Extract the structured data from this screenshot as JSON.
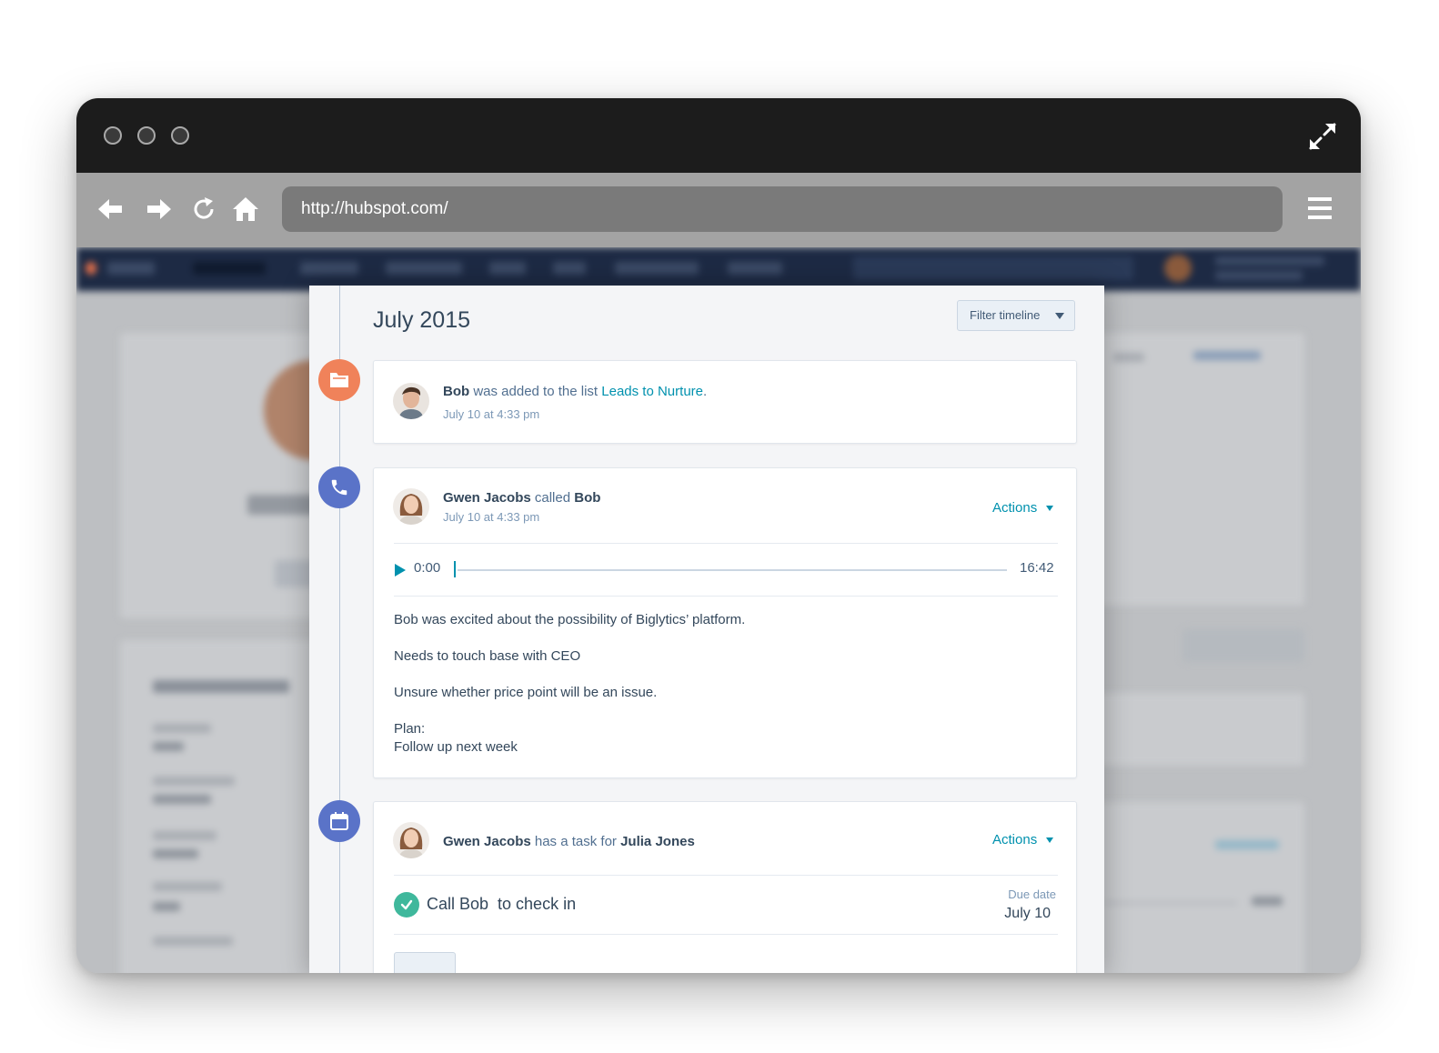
{
  "browser": {
    "url": "http://hubspot.com/"
  },
  "timeline": {
    "month": "July 2015",
    "filter_label": "Filter timeline",
    "events": [
      {
        "type": "list",
        "actor": "Bob",
        "verb": " was added to the list ",
        "target": "Leads to Nurture",
        "suffix": ".",
        "time": "July 10 at 4:33 pm"
      },
      {
        "type": "call",
        "actor": "Gwen Jacobs",
        "verb": " called ",
        "target": "Bob",
        "time": "July 10 at 4:33 pm",
        "actions_label": "Actions",
        "audio": {
          "start": "0:00",
          "end": "16:42",
          "progress": 0
        },
        "notes": [
          "Bob was excited about the possibility of Biglytics’ platform.",
          "Needs to touch base with CEO",
          "Unsure whether price point will be an issue.",
          "Plan:",
          "Follow up next week"
        ]
      },
      {
        "type": "task",
        "actor": "Gwen Jacobs",
        "verb": " has a task for ",
        "target": "Julia Jones",
        "actions_label": "Actions",
        "task_title": "Call Bob  to check in",
        "due_label": "Due date",
        "due_value": "July 10"
      }
    ]
  },
  "colors": {
    "list_icon": "#f0825a",
    "call_icon": "#5a73c8",
    "task_icon": "#5a73c8",
    "done_check": "#3fb89c",
    "link": "#0091ae"
  }
}
